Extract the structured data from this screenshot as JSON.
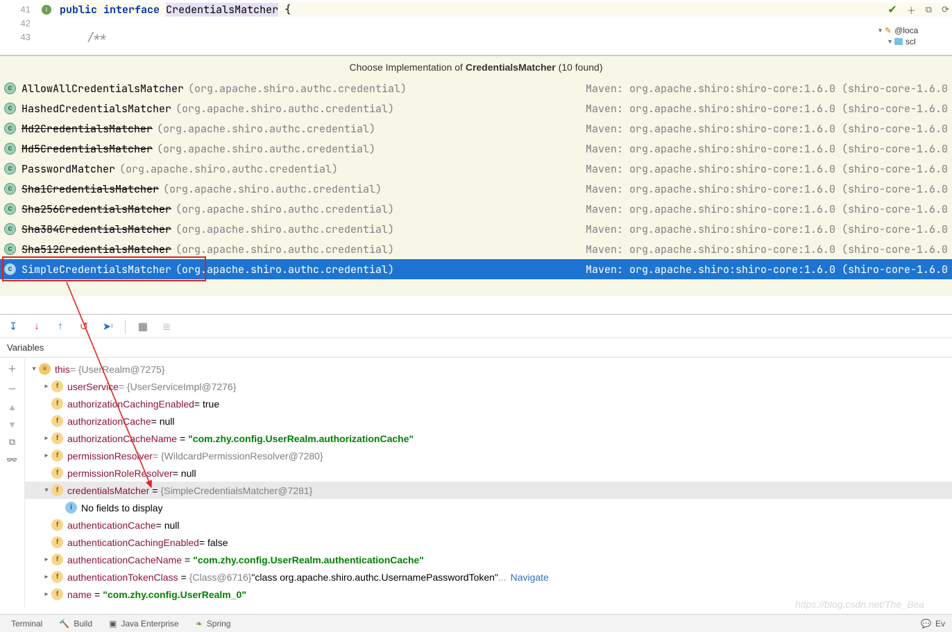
{
  "editor": {
    "lines": {
      "l41": "41",
      "l42": "42",
      "l43": "43"
    },
    "code": {
      "kw_public": "public",
      "kw_interface": "interface",
      "cls_name": "CredentialsMatcher",
      "brace": " {",
      "comment": "/**"
    },
    "sideTree": {
      "item1": "@loca",
      "item2": "scl"
    }
  },
  "popup": {
    "header_pre": "Choose Implementation of ",
    "header_cls": "CredentialsMatcher",
    "header_post": " (10 found)",
    "maven_text": "Maven: org.apache.shiro:shiro-core:1.6.0 (shiro-core-1.6.0",
    "items": [
      {
        "name": "AllowAllCredentialsMatcher",
        "pkg": "(org.apache.shiro.authc.credential)",
        "strike": false
      },
      {
        "name": "HashedCredentialsMatcher",
        "pkg": "(org.apache.shiro.authc.credential)",
        "strike": false
      },
      {
        "name": "Md2CredentialsMatcher",
        "pkg": "(org.apache.shiro.authc.credential)",
        "strike": true
      },
      {
        "name": "Md5CredentialsMatcher",
        "pkg": "(org.apache.shiro.authc.credential)",
        "strike": true
      },
      {
        "name": "PasswordMatcher",
        "pkg": "(org.apache.shiro.authc.credential)",
        "strike": false
      },
      {
        "name": "Sha1CredentialsMatcher",
        "pkg": "(org.apache.shiro.authc.credential)",
        "strike": true
      },
      {
        "name": "Sha256CredentialsMatcher",
        "pkg": "(org.apache.shiro.authc.credential)",
        "strike": true
      },
      {
        "name": "Sha384CredentialsMatcher",
        "pkg": "(org.apache.shiro.authc.credential)",
        "strike": true
      },
      {
        "name": "Sha512CredentialsMatcher",
        "pkg": "(org.apache.shiro.authc.credential)",
        "strike": true
      },
      {
        "name": "SimpleCredentialsMatcher",
        "pkg": "(org.apache.shiro.authc.credential)",
        "strike": false
      }
    ]
  },
  "debugger": {
    "vars_label": "Variables",
    "rows": {
      "this_name": "this",
      "this_val": " = {UserRealm@7275}",
      "userService_name": "userService",
      "userService_val": " = {UserServiceImpl@7276}",
      "authzCacheEnabled_name": "authorizationCachingEnabled",
      "authzCacheEnabled_val": " = true",
      "authzCache_name": "authorizationCache",
      "authzCache_val": " = null",
      "authzCacheName_name": "authorizationCacheName",
      "authzCacheName_eq": " = ",
      "authzCacheName_val": "\"com.zhy.config.UserRealm.authorizationCache\"",
      "permRes_name": "permissionResolver",
      "permRes_val": " = {WildcardPermissionResolver@7280}",
      "permRoleRes_name": "permissionRoleResolver",
      "permRoleRes_val": " = null",
      "credMatcher_name": "credentialsMatcher",
      "credMatcher_eq": " = ",
      "credMatcher_val": "{SimpleCredentialsMatcher@7281}",
      "noFields": "No fields to display",
      "authnCache_name": "authenticationCache",
      "authnCache_val": " = null",
      "authnCacheEnabled_name": "authenticationCachingEnabled",
      "authnCacheEnabled_val": " = false",
      "authnCacheName_name": "authenticationCacheName",
      "authnCacheName_eq": " = ",
      "authnCacheName_val": "\"com.zhy.config.UserRealm.authenticationCache\"",
      "authnTokenClass_name": "authenticationTokenClass",
      "authnTokenClass_eq": " = ",
      "authnTokenClass_g": "{Class@6716} ",
      "authnTokenClass_v": "\"class org.apache.shiro.authc.UsernamePasswordToken\"",
      "authnTokenClass_dots": " ... ",
      "authnTokenClass_nav": "Navigate",
      "name_name": "name",
      "name_eq": " = ",
      "name_val": "\"com.zhy.config.UserRealm_0\""
    }
  },
  "bottomBar": {
    "terminal": "Terminal",
    "build": "Build",
    "javaee": "Java Enterprise",
    "spring": "Spring",
    "ev": "Ev"
  },
  "watermark": "https://blog.csdn.net/The_Bea"
}
